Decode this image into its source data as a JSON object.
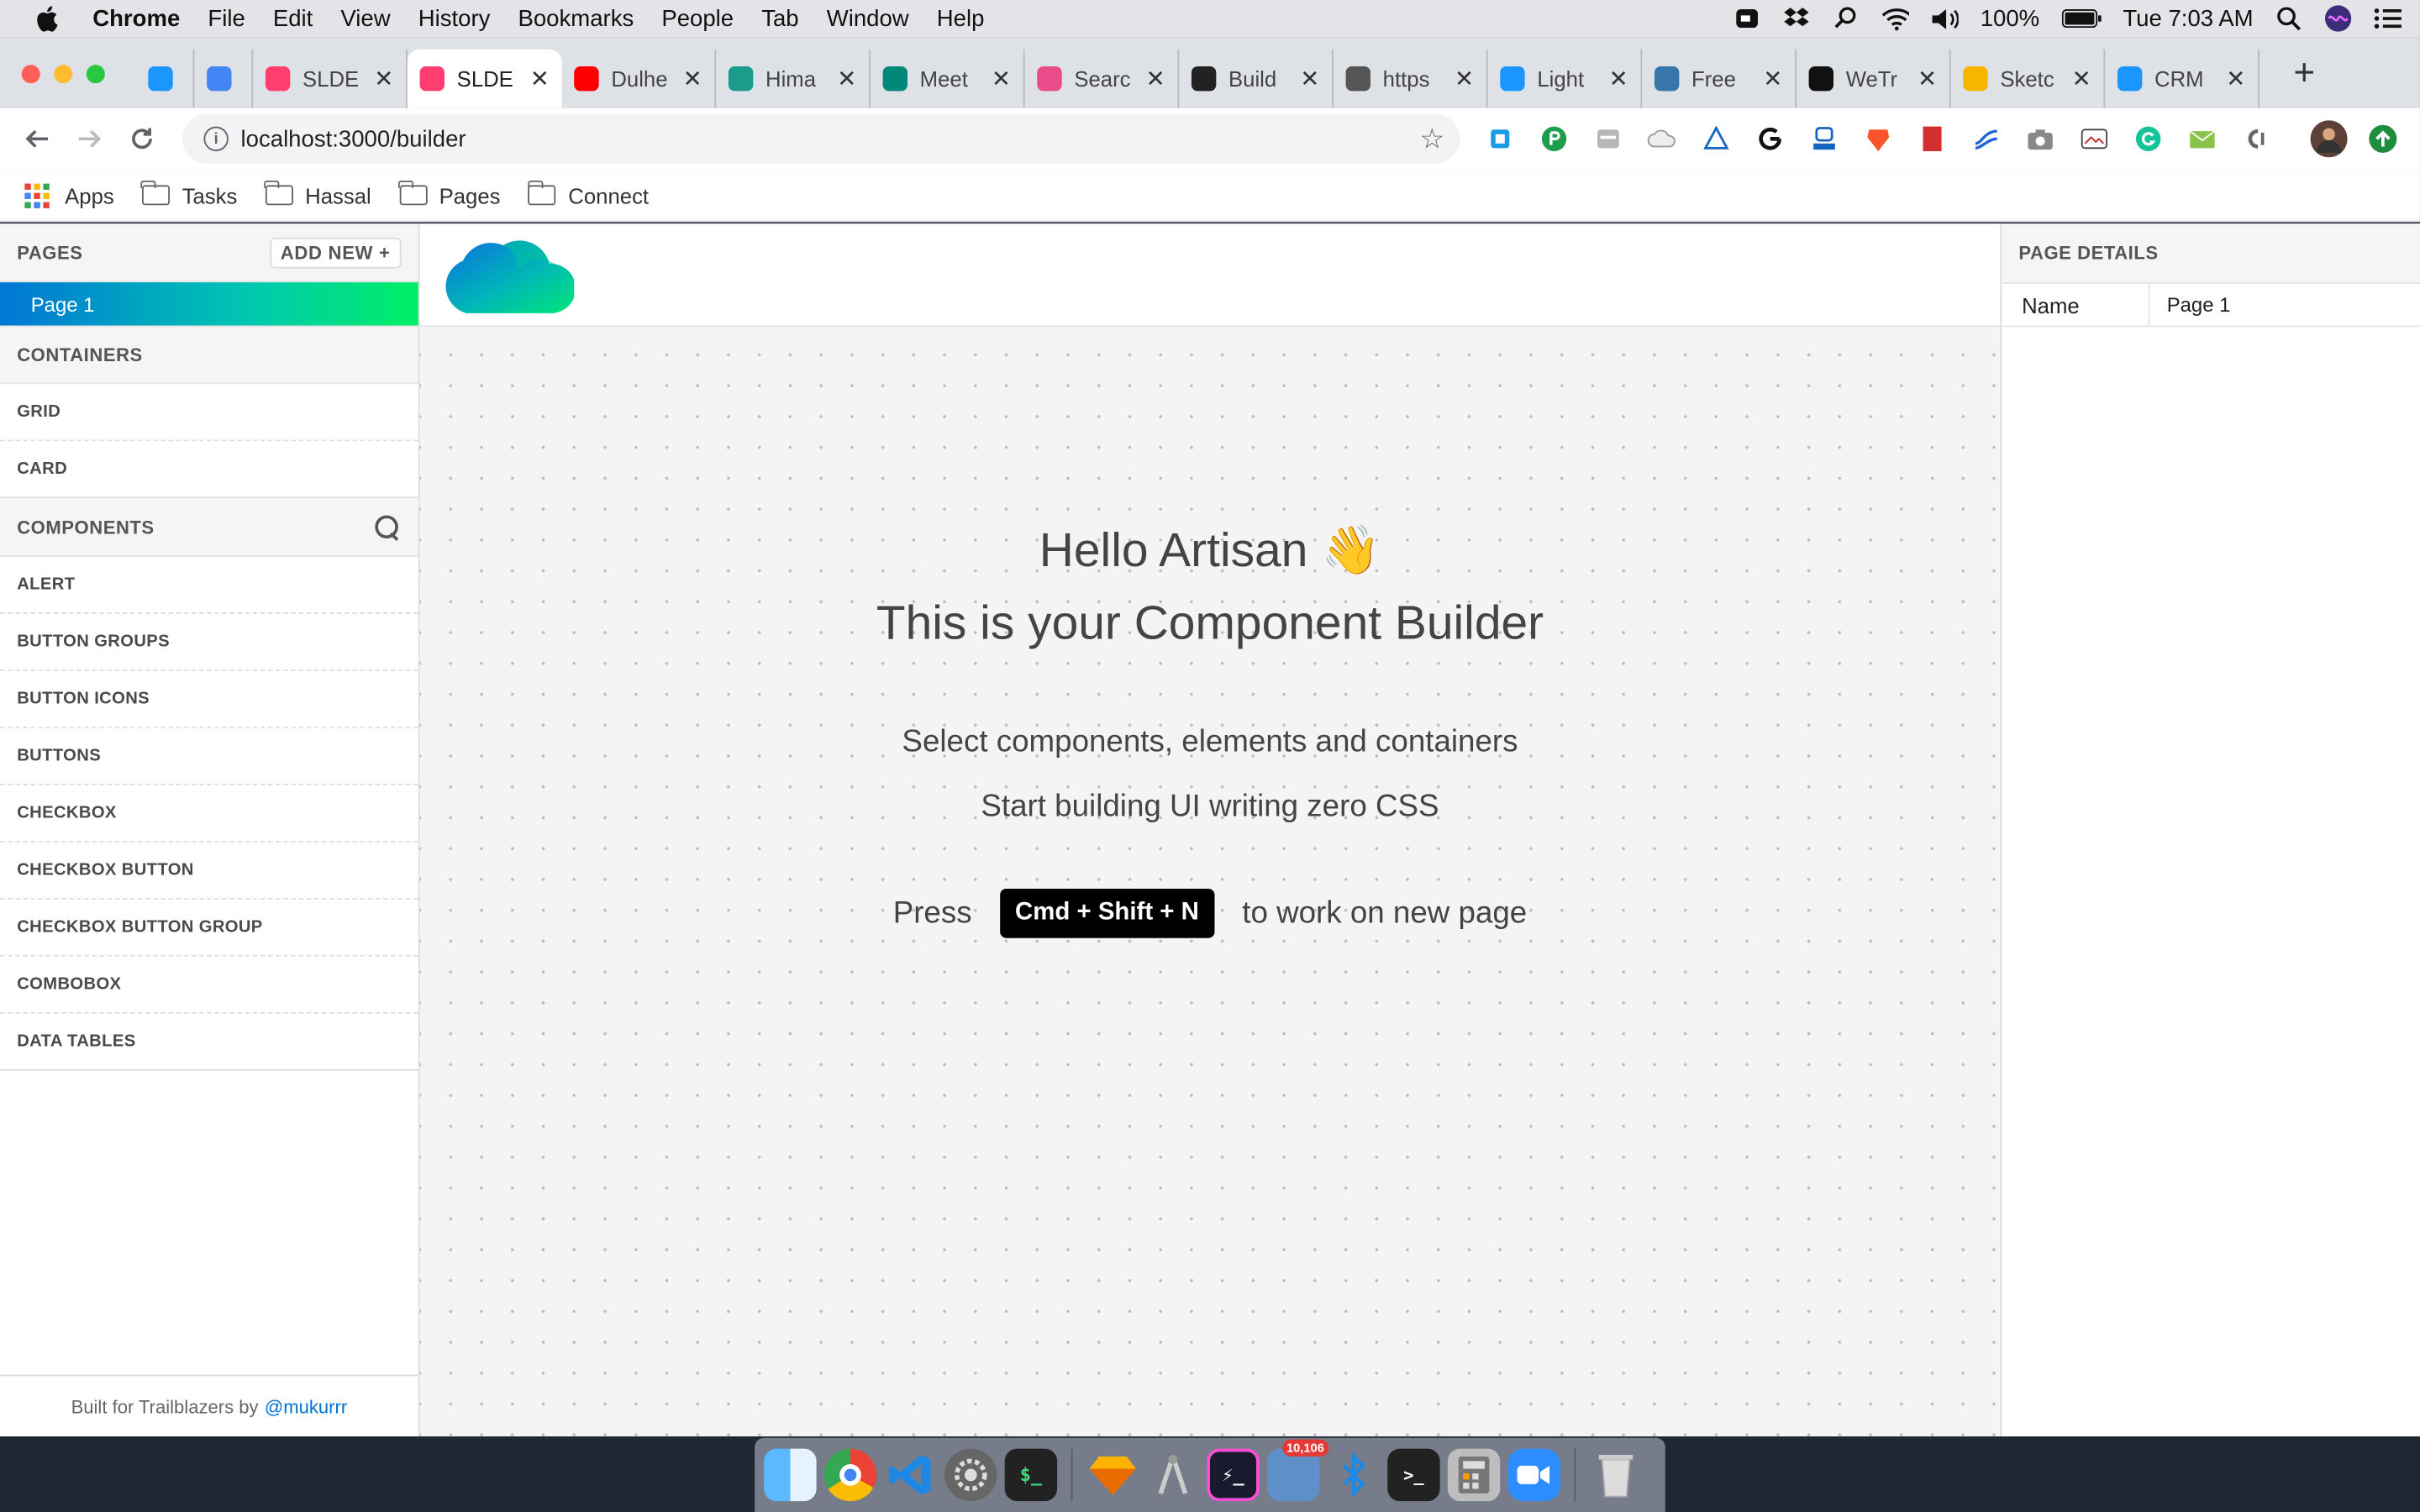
{
  "menubar": {
    "app_name": "Chrome",
    "menus": [
      "File",
      "Edit",
      "View",
      "History",
      "Bookmarks",
      "People",
      "Tab",
      "Window",
      "Help"
    ],
    "battery": "100%",
    "clock": "Tue 7:03 AM"
  },
  "tabs": [
    {
      "label": "",
      "icon": "salesforce-cloud-icon",
      "color": "#1b96ff"
    },
    {
      "label": "",
      "icon": "google-icon",
      "color": "#4285f4"
    },
    {
      "label": "SLDE",
      "icon": "sldb-icon",
      "color": "#ff3d6e"
    },
    {
      "label": "SLDE",
      "icon": "sldb-icon",
      "color": "#ff3d6e",
      "active": true
    },
    {
      "label": "Dulhe",
      "icon": "youtube-icon",
      "color": "#ff0000"
    },
    {
      "label": "Hima",
      "icon": "at-sign-icon",
      "color": "#1a9b8b"
    },
    {
      "label": "Meet",
      "icon": "meet-icon",
      "color": "#00897b"
    },
    {
      "label": "Searc",
      "icon": "dribbble-icon",
      "color": "#ea4c89"
    },
    {
      "label": "Build",
      "icon": "bx-icon",
      "color": "#222222"
    },
    {
      "label": "https",
      "icon": "globe-icon",
      "color": "#555555"
    },
    {
      "label": "Light",
      "icon": "salesforce-cloud-icon",
      "color": "#1b96ff"
    },
    {
      "label": "Free",
      "icon": "python-icon",
      "color": "#3776ab"
    },
    {
      "label": "WeTr",
      "icon": "wetransfer-icon",
      "color": "#111111"
    },
    {
      "label": "Sketc",
      "icon": "sketch-icon",
      "color": "#f7b500"
    },
    {
      "label": "CRM",
      "icon": "salesforce-cloud-icon",
      "color": "#1b96ff"
    }
  ],
  "address_bar": {
    "url": "localhost:3000/builder"
  },
  "bookmarks": {
    "apps_label": "Apps",
    "folders": [
      "Tasks",
      "Hassal",
      "Pages",
      "Connect"
    ]
  },
  "sidebar": {
    "pages_header": "PAGES",
    "add_new_label": "ADD NEW",
    "pages": [
      "Page 1"
    ],
    "containers_header": "CONTAINERS",
    "containers": [
      "GRID",
      "CARD"
    ],
    "components_header": "COMPONENTS",
    "components": [
      "ALERT",
      "BUTTON GROUPS",
      "BUTTON ICONS",
      "BUTTONS",
      "CHECKBOX",
      "CHECKBOX BUTTON",
      "CHECKBOX BUTTON GROUP",
      "COMBOBOX",
      "DATA TABLES"
    ],
    "footer_text": "Built for Trailblazers by",
    "footer_handle": "@mukurrr"
  },
  "canvas": {
    "hello": "Hello Artisan",
    "wave": "👋",
    "subtitle": "This is your Component Builder",
    "desc1": "Select components, elements and containers",
    "desc2": "Start building UI writing zero CSS",
    "press": "Press",
    "shortcut": "Cmd + Shift + N",
    "after_shortcut": "to work on new page"
  },
  "details": {
    "header": "PAGE DETAILS",
    "name_label": "Name",
    "name_value": "Page 1"
  },
  "dock": {
    "badge": "10,106"
  },
  "colors": {
    "accent_gradient_start": "#0076d6",
    "accent_gradient_end": "#00ef64",
    "link": "#0070d2"
  }
}
